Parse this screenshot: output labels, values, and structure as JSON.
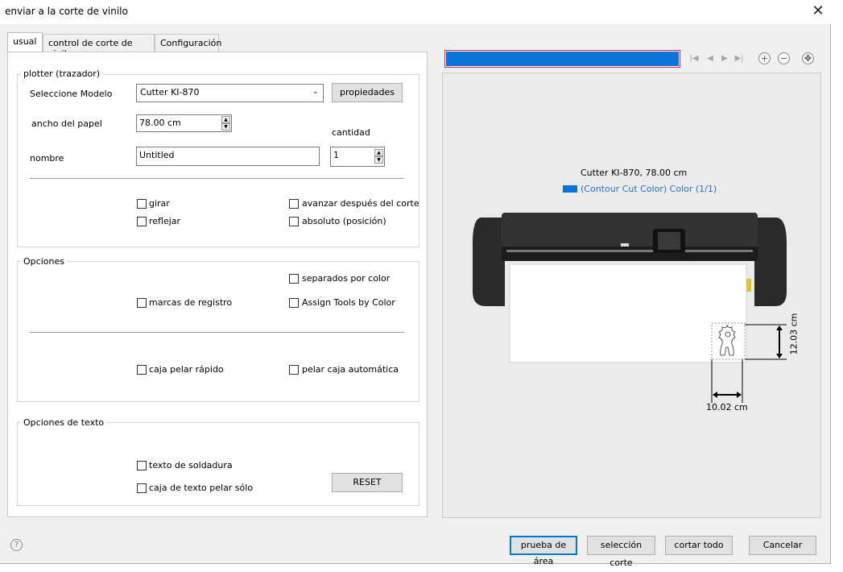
{
  "window": {
    "title": "enviar a la corte de vinilo"
  },
  "tabs": [
    {
      "label": "usual"
    },
    {
      "label": "control de corte de vinilo"
    },
    {
      "label": "Configuración"
    }
  ],
  "plotter": {
    "legend": "plotter (trazador)",
    "model_label": "Seleccione Modelo",
    "model_value": "Cutter KI-870",
    "properties_button": "propiedades",
    "width_label": "ancho del papel",
    "width_value": "78.00 cm",
    "quantity_label": "cantidad",
    "quantity_value": "1",
    "name_label": "nombre",
    "name_value": "Untitled",
    "rotate": "girar",
    "mirror": "reflejar",
    "advance_after_cut": "avanzar después del corte",
    "absolute_position": "absoluto (posición)"
  },
  "options": {
    "legend": "Opciones",
    "separated_by_color": "separados por color",
    "registration_marks": "marcas de registro",
    "assign_tools": "Assign Tools by Color",
    "quick_weed_box": "caja pelar rápido",
    "auto_weed_box": "pelar caja automática"
  },
  "text_options": {
    "legend": "Opciones de texto",
    "weld_text": "texto de soldadura",
    "weed_text_box": "caja de texto pelar sólo",
    "reset_button": "RESET"
  },
  "preview": {
    "progress_fraction": 1.0,
    "header": "Cutter KI-870,  78.00 cm",
    "color_label": "(Contour Cut Color) Color (1/1)",
    "color_hex": "#0a74da",
    "height_dim": "12.03 cm",
    "width_dim": "10.02 cm"
  },
  "footer": {
    "area_test": "prueba de área",
    "cut_selection": "selección corte",
    "cut_all": "cortar todo",
    "cancel": "Cancelar"
  }
}
